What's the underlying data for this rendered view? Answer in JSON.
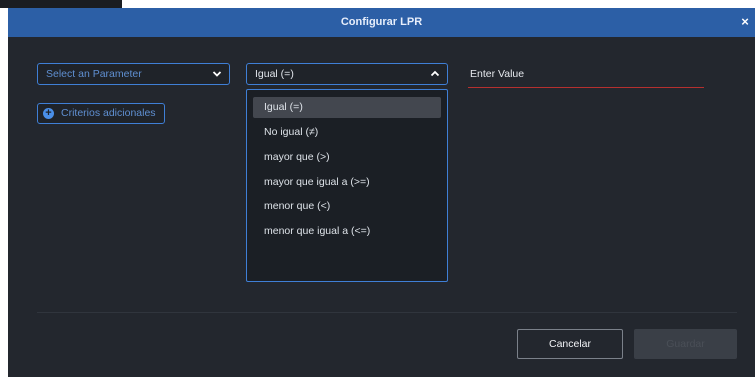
{
  "dialog": {
    "title": "Configurar LPR",
    "close_label": "×"
  },
  "parameter_select": {
    "selected": "Select an Parameter"
  },
  "operator_select": {
    "selected": "Igual (=)",
    "options": [
      "Igual (=)",
      "No igual (≠)",
      "mayor que (>)",
      "mayor que igual a (>=)",
      "menor que (<)",
      "menor que igual a (<=)"
    ]
  },
  "value_field": {
    "placeholder": "Enter Value"
  },
  "add_criteria": {
    "label": "Criterios adicionales"
  },
  "footer": {
    "cancel_label": "Cancelar",
    "save_label": "Guardar"
  },
  "colors": {
    "titlebar": "#2c5fa6",
    "accent": "#3f7fd6",
    "error_underline": "#b5302f",
    "background": "#23272e"
  }
}
